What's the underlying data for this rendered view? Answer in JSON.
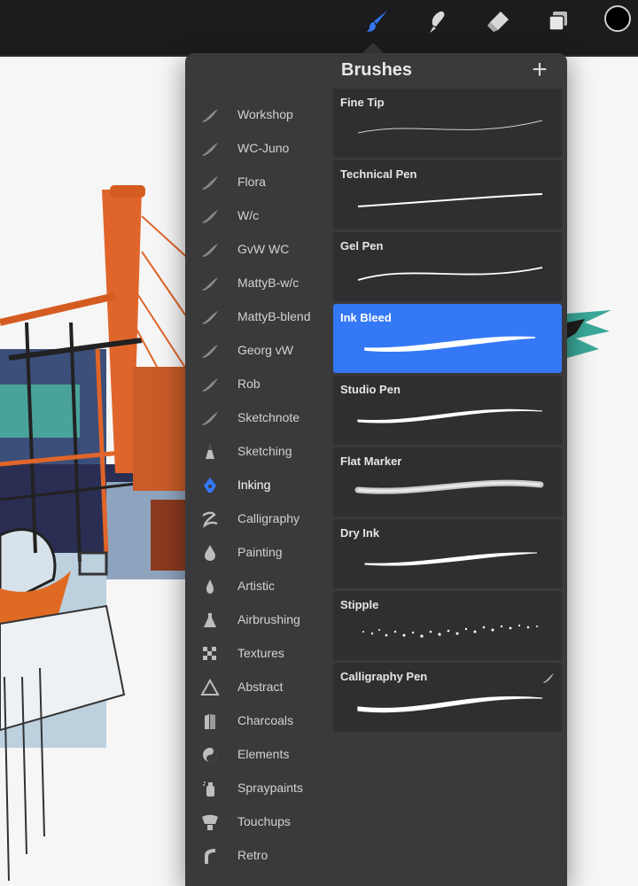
{
  "toolbar": {
    "tools": [
      {
        "name": "brush-icon",
        "active": true
      },
      {
        "name": "smudge-icon",
        "active": false
      },
      {
        "name": "eraser-icon",
        "active": false
      },
      {
        "name": "layers-icon",
        "active": false
      },
      {
        "name": "color-swatch",
        "active": false
      }
    ],
    "active_color": "#3478f6",
    "current_color": "#000000"
  },
  "brushes_panel": {
    "title": "Brushes",
    "add_label": "+",
    "libraries": [
      {
        "label": "Workshop",
        "icon": "brush-stroke-icon"
      },
      {
        "label": "WC-Juno",
        "icon": "brush-stroke-icon"
      },
      {
        "label": "Flora",
        "icon": "brush-stroke-icon"
      },
      {
        "label": "W/c",
        "icon": "brush-stroke-icon"
      },
      {
        "label": "GvW WC",
        "icon": "brush-stroke-icon"
      },
      {
        "label": "MattyB-w/c",
        "icon": "brush-stroke-icon"
      },
      {
        "label": "MattyB-blend",
        "icon": "brush-stroke-icon"
      },
      {
        "label": "Georg vW",
        "icon": "brush-stroke-icon"
      },
      {
        "label": "Rob",
        "icon": "brush-stroke-icon"
      },
      {
        "label": "Sketchnote",
        "icon": "brush-stroke-icon"
      },
      {
        "label": "Sketching",
        "icon": "pencil-tip-icon"
      },
      {
        "label": "Inking",
        "icon": "pen-nib-icon",
        "active": true
      },
      {
        "label": "Calligraphy",
        "icon": "calligraphy-icon"
      },
      {
        "label": "Painting",
        "icon": "paint-drop-icon"
      },
      {
        "label": "Artistic",
        "icon": "artistic-drop-icon"
      },
      {
        "label": "Airbrushing",
        "icon": "airbrush-icon"
      },
      {
        "label": "Textures",
        "icon": "checker-icon"
      },
      {
        "label": "Abstract",
        "icon": "triangle-icon"
      },
      {
        "label": "Charcoals",
        "icon": "charcoal-icon"
      },
      {
        "label": "Elements",
        "icon": "yin-yang-icon"
      },
      {
        "label": "Spraypaints",
        "icon": "spray-can-icon"
      },
      {
        "label": "Touchups",
        "icon": "touchup-icon"
      },
      {
        "label": "Retro",
        "icon": "retro-icon"
      }
    ],
    "brushes": [
      {
        "name": "Fine Tip",
        "stroke": "fine"
      },
      {
        "name": "Technical Pen",
        "stroke": "technical"
      },
      {
        "name": "Gel Pen",
        "stroke": "gel"
      },
      {
        "name": "Ink Bleed",
        "stroke": "bleed",
        "selected": true
      },
      {
        "name": "Studio Pen",
        "stroke": "studio"
      },
      {
        "name": "Flat Marker",
        "stroke": "marker"
      },
      {
        "name": "Dry Ink",
        "stroke": "dry"
      },
      {
        "name": "Stipple",
        "stroke": "stipple"
      },
      {
        "name": "Calligraphy Pen",
        "stroke": "calligraphy",
        "badge": "brush-stroke-icon"
      }
    ],
    "selected_color": "#3478f6"
  }
}
